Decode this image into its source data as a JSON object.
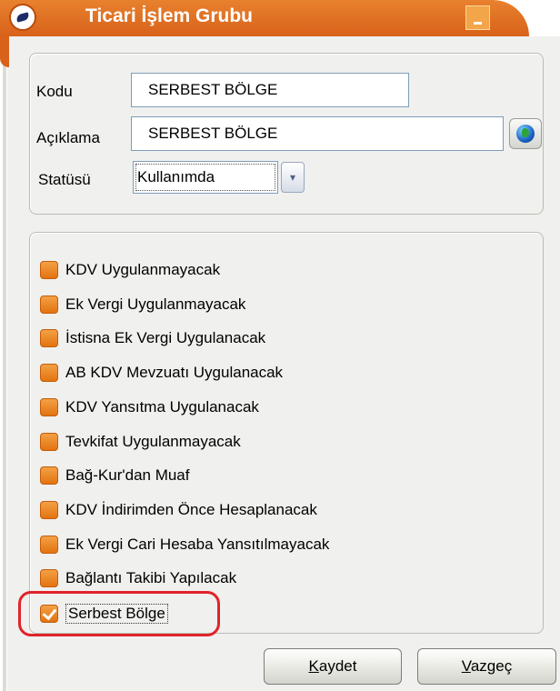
{
  "window": {
    "title": "Ticari İşlem Grubu",
    "accent_color": "#d8621a"
  },
  "form": {
    "kodu_label": "Kodu",
    "kodu_value": "SERBEST BÖLGE",
    "aciklama_label": "Açıklama",
    "aciklama_value": "SERBEST BÖLGE",
    "statusu_label": "Statüsü",
    "statusu_value": "Kullanımda"
  },
  "options": [
    {
      "label": "KDV Uygulanmayacak",
      "checked": false
    },
    {
      "label": "Ek Vergi Uygulanmayacak",
      "checked": false
    },
    {
      "label": "İstisna Ek Vergi Uygulanacak",
      "checked": false
    },
    {
      "label": "AB KDV Mevzuatı Uygulanacak",
      "checked": false
    },
    {
      "label": "KDV Yansıtma Uygulanacak",
      "checked": false
    },
    {
      "label": "Tevkifat Uygulanmayacak",
      "checked": false
    },
    {
      "label": "Bağ-Kur'dan Muaf",
      "checked": false
    },
    {
      "label": "KDV İndirimden Önce Hesaplanacak",
      "checked": false
    },
    {
      "label": "Ek Vergi Cari Hesaba Yansıtılmayacak",
      "checked": false
    },
    {
      "label": "Bağlantı Takibi Yapılacak",
      "checked": false
    },
    {
      "label": "Serbest Bölge",
      "checked": true
    }
  ],
  "buttons": {
    "save_first": "K",
    "save_rest": "aydet",
    "cancel_first": "V",
    "cancel_rest": "azgeç"
  },
  "icons": {
    "app": "app-logo-icon",
    "minimize": "minimize-icon",
    "globe": "globe-icon",
    "dropdown": "chevron-down-icon"
  }
}
